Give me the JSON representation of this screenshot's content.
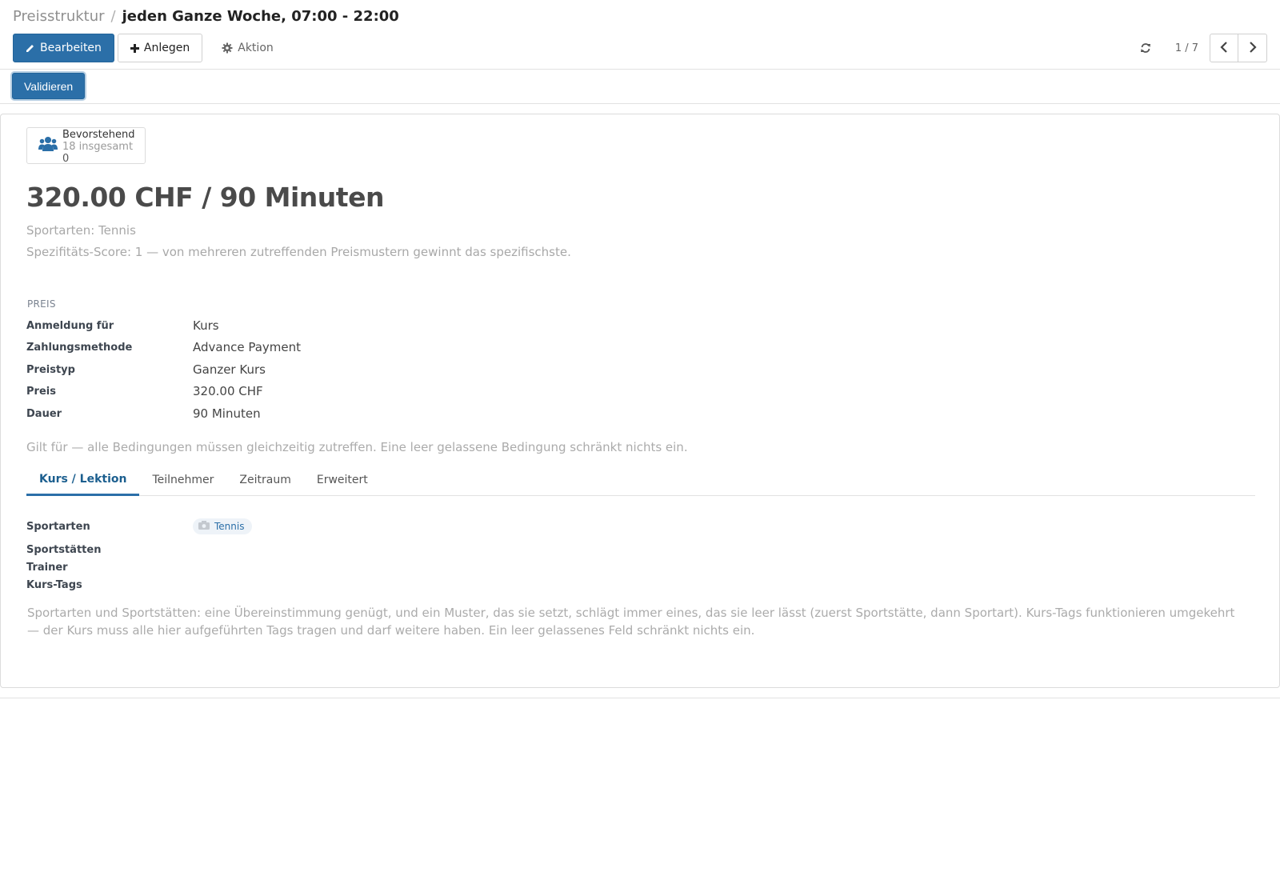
{
  "breadcrumb": {
    "parent": "Preisstruktur",
    "separator": "/",
    "current": "jeden Ganze Woche, 07:00 - 22:00"
  },
  "toolbar": {
    "edit_label": "Bearbeiten",
    "create_label": "Anlegen",
    "action_label": "Aktion"
  },
  "pager": {
    "value": "1 / 7"
  },
  "statusbar": {
    "validate_label": "Validieren"
  },
  "stat_button": {
    "title": "Bevorstehend",
    "subtitle": "18 insgesamt",
    "value": "0",
    "icon": "users-icon"
  },
  "record": {
    "title": "320.00 CHF / 90 Minuten",
    "description_sports": "Sportarten: Tennis",
    "description_score": "Spezifitäts-Score: 1 — von mehreren zutreffenden Preismustern gewinnt das spezifischste."
  },
  "price_section": {
    "title": "Preis",
    "fields": [
      {
        "label": "Anmeldung für",
        "value": "Kurs"
      },
      {
        "label": "Zahlungsmethode",
        "value": "Advance Payment"
      },
      {
        "label": "Preistyp",
        "value": "Ganzer Kurs"
      },
      {
        "label": "Preis",
        "value": "320.00 CHF"
      },
      {
        "label": "Dauer",
        "value": "90 Minuten"
      }
    ]
  },
  "conditions_hint": "Gilt für — alle Bedingungen müssen gleichzeitig zutreffen. Eine leer gelassene Bedingung schränkt nichts ein.",
  "tabs": [
    {
      "label": "Kurs / Lektion",
      "active": true
    },
    {
      "label": "Teilnehmer",
      "active": false
    },
    {
      "label": "Zeitraum",
      "active": false
    },
    {
      "label": "Erweitert",
      "active": false
    }
  ],
  "course_tab": {
    "fields": [
      {
        "label": "Sportarten",
        "value": "Tennis"
      },
      {
        "label": "Sportstätten",
        "value": ""
      },
      {
        "label": "Trainer",
        "value": ""
      },
      {
        "label": "Kurs-Tags",
        "value": ""
      }
    ],
    "hint": "Sportarten und Sportstätten: eine Übereinstimmung genügt, und ein Muster, das sie setzt, schlägt immer eines, das sie leer lässt (zuerst Sportstätte, dann Sportart). Kurs-Tags funktionieren umgekehrt — der Kurs muss alle hier aufgeführten Tags tragen und darf weitere haben. Ein leer gelassenes Feld schränkt nichts ein."
  },
  "colors": {
    "primary": "#2b6fa8",
    "active_tab": "#1c5f8f",
    "muted_text": "#ababab"
  }
}
